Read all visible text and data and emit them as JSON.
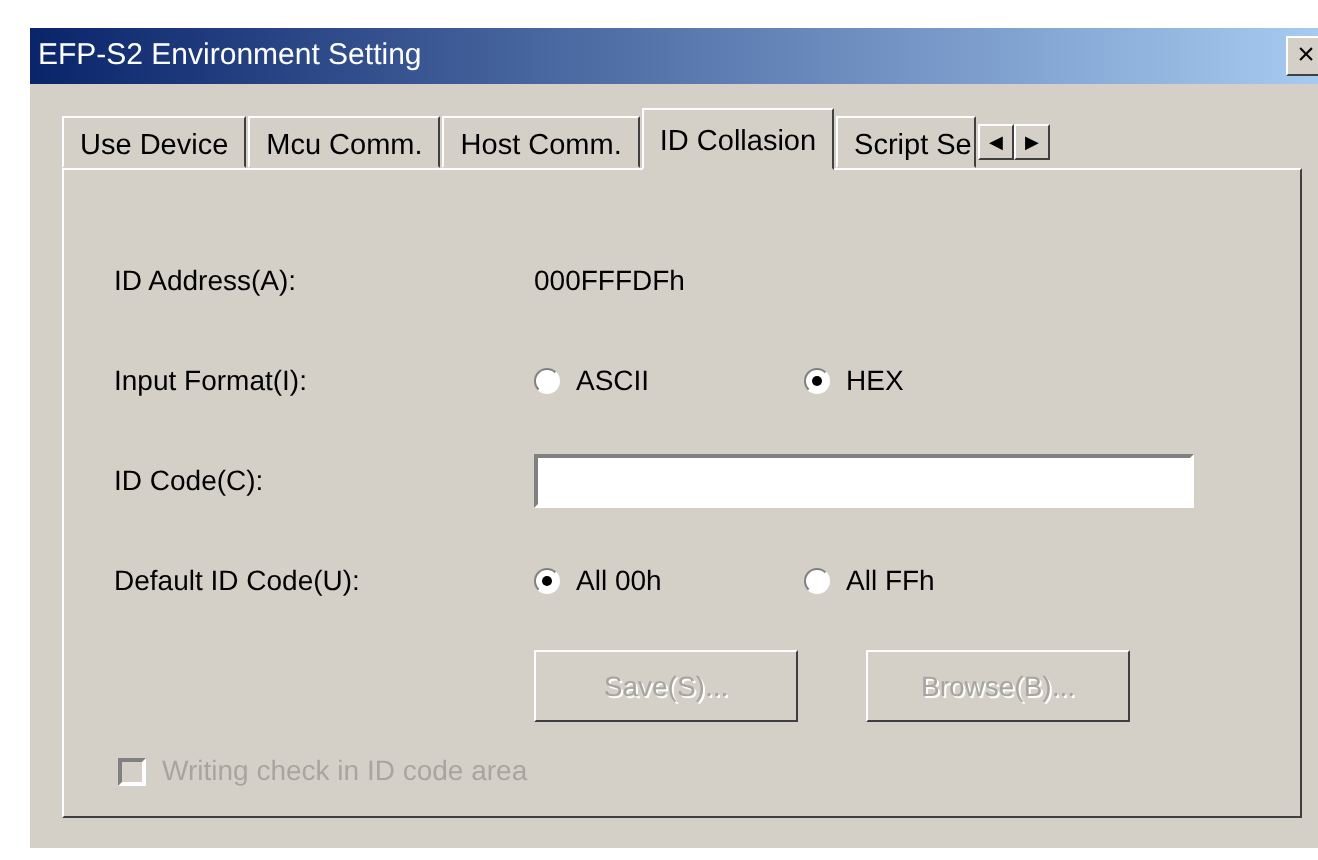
{
  "window": {
    "title": "EFP-S2 Environment Setting",
    "close": "×"
  },
  "tabs": [
    {
      "label": "Use Device",
      "selected": false
    },
    {
      "label": "Mcu Comm.",
      "selected": false
    },
    {
      "label": "Host Comm.",
      "selected": false
    },
    {
      "label": "ID Collasion",
      "selected": true
    },
    {
      "label": "Script Se",
      "selected": false
    }
  ],
  "tab_scroll": [
    "◀",
    "▶"
  ],
  "id_address": {
    "label": "ID Address(A):",
    "value": "000FFFDFh"
  },
  "input_format": {
    "label": "Input Format(I):",
    "options": [
      {
        "label": "ASCII",
        "selected": false
      },
      {
        "label": "HEX",
        "selected": true
      }
    ]
  },
  "id_code": {
    "label": "ID Code(C):"
  },
  "default_id_code": {
    "label": "Default ID Code(U):",
    "options": [
      {
        "label": "All 00h",
        "selected": true
      },
      {
        "label": "All FFh",
        "selected": false
      }
    ]
  },
  "buttons": [
    {
      "label": "Save(S)...",
      "disabled": true
    },
    {
      "label": "Browse(B)...",
      "disabled": true
    }
  ],
  "writing_check": {
    "label": "Writing check in ID code area",
    "checked": false,
    "disabled": true
  }
}
